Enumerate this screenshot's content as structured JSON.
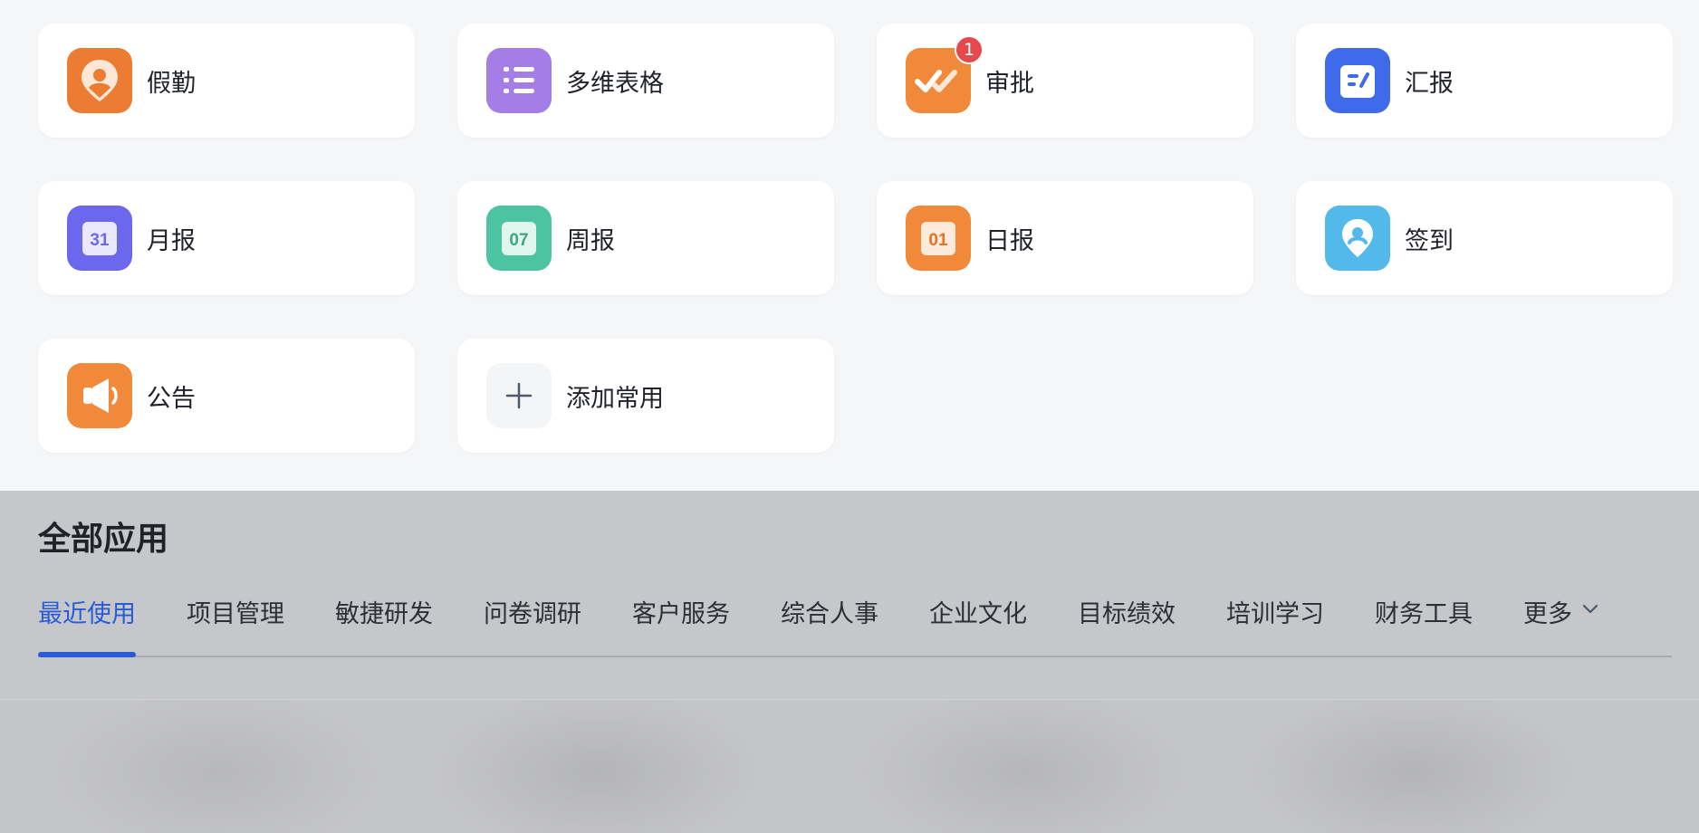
{
  "frequent_apps": [
    {
      "label": "假勤",
      "icon": "attendance-pin-icon",
      "color": "#ec7c31"
    },
    {
      "label": "多维表格",
      "icon": "list-icon",
      "color": "#a57de6"
    },
    {
      "label": "审批",
      "icon": "approval-check-icon",
      "color": "#f08a3a",
      "badge": "1"
    },
    {
      "label": "汇报",
      "icon": "report-edit-icon",
      "color": "#3f6bea"
    },
    {
      "label": "月报",
      "icon": "calendar-31-icon",
      "color": "#6b68ee",
      "icon_text": "31"
    },
    {
      "label": "周报",
      "icon": "calendar-07-icon",
      "color": "#4cc3a1",
      "icon_text": "07"
    },
    {
      "label": "日报",
      "icon": "calendar-01-icon",
      "color": "#f08a3a",
      "icon_text": "01"
    },
    {
      "label": "签到",
      "icon": "checkin-pin-icon",
      "color": "#53b8ea"
    },
    {
      "label": "公告",
      "icon": "megaphone-icon",
      "color": "#f08a3a"
    },
    {
      "label": "添加常用",
      "icon": "plus-icon",
      "color": "#f4f5f7"
    }
  ],
  "all_apps": {
    "title": "全部应用",
    "tabs": [
      "最近使用",
      "项目管理",
      "敏捷研发",
      "问卷调研",
      "客户服务",
      "综合人事",
      "企业文化",
      "目标绩效",
      "培训学习",
      "财务工具"
    ],
    "active_tab": "最近使用",
    "more_label": "更多",
    "accent_color": "#2a5bd7"
  }
}
